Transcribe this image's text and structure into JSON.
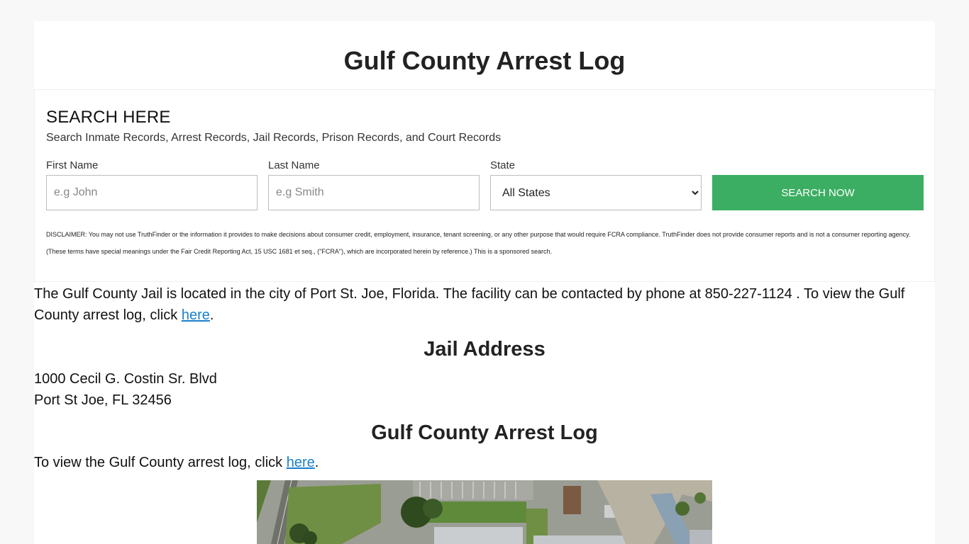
{
  "page": {
    "title": "Gulf County Arrest Log"
  },
  "search": {
    "heading": "SEARCH HERE",
    "subheading": "Search Inmate Records, Arrest Records, Jail Records, Prison Records, and Court Records",
    "first_name_label": "First Name",
    "first_name_placeholder": "e.g John",
    "last_name_label": "Last Name",
    "last_name_placeholder": "e.g Smith",
    "state_label": "State",
    "state_selected": "All States",
    "button_label": "SEARCH NOW",
    "disclaimer": "DISCLAIMER: You may not use TruthFinder or the information it provides to make decisions about consumer credit, employment, insurance, tenant screening, or any other purpose that would require FCRA compliance. TruthFinder does not provide consumer reports and is not a consumer reporting agency. (These terms have special meanings under the Fair Credit Reporting Act, 15 USC 1681 et seq., (\"FCRA\"), which are incorporated herein by reference.) This is a sponsored search."
  },
  "intro": {
    "text_before": "The Gulf County Jail is located in the city of Port St. Joe, Florida. The facility can be contacted by phone at 850-227-1124 . To view the Gulf County arrest log, click ",
    "link_text": "here",
    "text_after": "."
  },
  "address": {
    "heading": "Jail Address",
    "line1": "1000 Cecil G. Costin Sr. Blvd",
    "line2": "Port St Joe, FL 32456"
  },
  "arrest_log": {
    "heading": "Gulf County Arrest Log",
    "text_before": "To view the Gulf County arrest log, click ",
    "link_text": "here",
    "text_after": "."
  },
  "colors": {
    "button": "#3cae63",
    "link": "#1a7fcc",
    "background": "#f8f8f8"
  }
}
